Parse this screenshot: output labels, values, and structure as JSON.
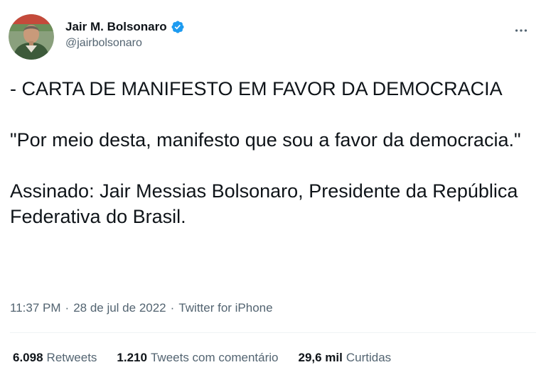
{
  "author": {
    "display_name": "Jair M. Bolsonaro",
    "handle": "@jairbolsonaro",
    "verified": true,
    "verified_color": "#1d9bf0"
  },
  "tweet": {
    "paragraphs": [
      "- CARTA DE MANIFESTO EM FAVOR DA DEMOCRACIA",
      "\"Por meio desta, manifesto que sou a favor da democracia.\"",
      "Assinado: Jair Messias Bolsonaro, Presidente da República Federativa do Brasil."
    ],
    "time": "11:37 PM",
    "date": "28 de jul de 2022",
    "source": "Twitter for iPhone",
    "separator": "·"
  },
  "stats": [
    {
      "count": "6.098",
      "label": "Retweets"
    },
    {
      "count": "1.210",
      "label": "Tweets com comentário"
    },
    {
      "count": "29,6 mil",
      "label": "Curtidas"
    }
  ],
  "icons": {
    "more": "more-dots-icon",
    "verified": "verified-badge-icon"
  }
}
